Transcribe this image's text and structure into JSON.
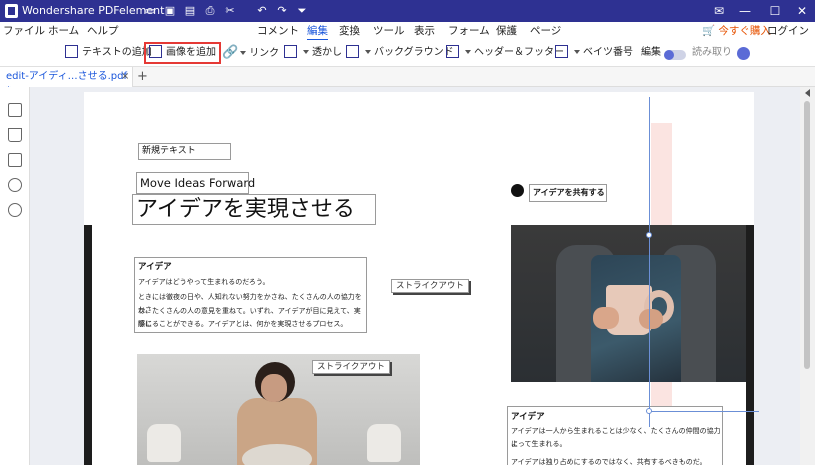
{
  "titlebar": {
    "app_title": "Wondershare PDFelement"
  },
  "menu": [
    "ファイル",
    "ホーム",
    "ヘルプ",
    "コメント",
    "編集",
    "変換",
    "ツール",
    "表示",
    "フォーム",
    "保護",
    "ページ"
  ],
  "menu_right": {
    "buy": "今すぐ購入",
    "login": "ログイン"
  },
  "toolbar": {
    "add_text": "テキストの追加",
    "add_image": "画像を追加",
    "link": "リンク",
    "watermark": "透かし",
    "background": "バックグラウンド",
    "header_footer": "ヘッダー＆フッター",
    "bates": "ベイツ番号",
    "edit": "編集",
    "read_only": "読み取り"
  },
  "tab": {
    "name": "edit-アイディ…させる.pdf *",
    "close": "×",
    "new": "+"
  },
  "page": {
    "new_text": "新規テキスト",
    "move_ideas": "Move Ideas Forward",
    "headline": "アイデアを実現させる",
    "share_label": "アイデアを共有する",
    "strike_1": "ストライクアウト",
    "strike_2": "ストライクアウト",
    "left_heading": "アイデア",
    "left_body": [
      "アイデアはどうやって生まれるのだろう。",
      "ときには徹夜の日や、人知れない努力をかさね、たくさんの人の協力をかさ",
      "ね、たくさんの人の意見を重ねて。いずれ、アイデアが目に見えて、実際に",
      "感じることができる。アイデアとは、何かを実現させるプロセス。"
    ],
    "right_heading": "アイデア",
    "right_body": [
      "アイデアは一人から生まれることは少なく、たくさんの仲間の協力に",
      "よって生まれる。",
      "アイデアは独り占めにするのではなく、共有するべきものだ。"
    ]
  }
}
